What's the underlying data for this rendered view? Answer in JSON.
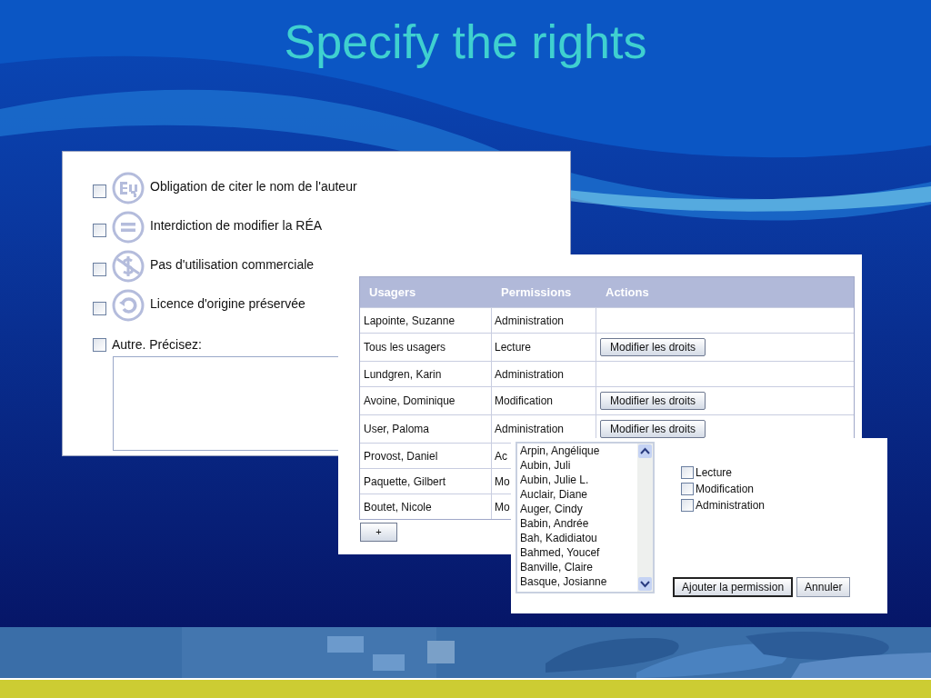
{
  "title": "Specify the rights",
  "license_panel": {
    "options": [
      {
        "kind": "by",
        "label": "Obligation de citer le nom de l'auteur",
        "checked": false
      },
      {
        "kind": "nd",
        "label": "Interdiction de modifier la RÉA",
        "checked": false
      },
      {
        "kind": "nc",
        "label": "Pas d'utilisation commerciale",
        "checked": false
      },
      {
        "kind": "sa",
        "label": "Licence d'origine préservée",
        "checked": false
      }
    ],
    "other": {
      "label": "Autre. Précisez:",
      "checked": false
    }
  },
  "users_table": {
    "columns": [
      "Usagers",
      "Permissions",
      "Actions"
    ],
    "rows": [
      {
        "user": "Lapointe, Suzanne",
        "permission": "Administration"
      },
      {
        "user": "Tous les usagers",
        "permission": "Lecture",
        "action": "Modifier les droits"
      },
      {
        "user": "Lundgren, Karin",
        "permission": "Administration"
      },
      {
        "user": "Avoine, Dominique",
        "permission": "Modification",
        "action": "Modifier les droits"
      },
      {
        "user": "User, Paloma",
        "permission": "Administration",
        "action": "Modifier les droits"
      },
      {
        "user": "Provost, Daniel",
        "permission": "Ac"
      },
      {
        "user": "Paquette, Gilbert",
        "permission": "Mo"
      },
      {
        "user": "Boutet, Nicole",
        "permission": "Mo"
      }
    ],
    "add_button": "+"
  },
  "permission_dialog": {
    "users": [
      "Arpin, Angélique",
      "Aubin, Juli",
      "Aubin, Julie L.",
      "Auclair, Diane",
      "Auger, Cindy",
      "Babin, Andrée",
      "Bah, Kadidiatou",
      "Bahmed, Youcef",
      "Banville, Claire",
      "Basque, Josianne"
    ],
    "permissions": [
      {
        "label": "Lecture",
        "checked": false
      },
      {
        "label": "Modification",
        "checked": false
      },
      {
        "label": "Administration",
        "checked": false
      }
    ],
    "buttons": [
      {
        "kind": "primary",
        "label": "Ajouter la permission"
      },
      {
        "kind": "secondary",
        "label": "Annuler"
      }
    ]
  }
}
